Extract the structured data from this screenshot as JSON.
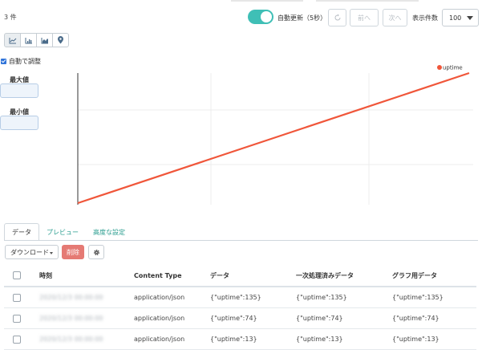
{
  "count_label": "3 件",
  "toolbar": {
    "auto_refresh_label": "自動更新（5秒）",
    "prev_label": "前へ",
    "next_label": "次へ",
    "per_page_label": "表示件数",
    "per_page_value": "100"
  },
  "chart_types": [
    "line-chart-icon",
    "bar-chart-icon",
    "area-chart-icon",
    "map-pin-icon"
  ],
  "autoscale_label": "自動で調整",
  "max_label": "最大値",
  "min_label": "最小値",
  "chart_data": {
    "type": "line",
    "series": [
      {
        "name": "uptime",
        "color": "#f0563a",
        "x": [
          0,
          1,
          2
        ],
        "values": [
          13,
          74,
          135
        ]
      }
    ],
    "legend": "top-right",
    "grid": true
  },
  "tabs": [
    "データ",
    "プレビュー",
    "高度な設定"
  ],
  "actions": {
    "download_label": "ダウンロード",
    "delete_label": "削除"
  },
  "table": {
    "headers": [
      "時刻",
      "Content Type",
      "データ",
      "一次処理済みデータ",
      "グラフ用データ"
    ],
    "rows": [
      {
        "time": "2020/12/3 00:00:00",
        "ctype": "application/json",
        "data": "{\"uptime\":135}",
        "processed": "{\"uptime\":135}",
        "graph": "{\"uptime\":135}"
      },
      {
        "time": "2020/12/3 00:00:00",
        "ctype": "application/json",
        "data": "{\"uptime\":74}",
        "processed": "{\"uptime\":74}",
        "graph": "{\"uptime\":74}"
      },
      {
        "time": "2020/12/3 00:00:00",
        "ctype": "application/json",
        "data": "{\"uptime\":13}",
        "processed": "{\"uptime\":13}",
        "graph": "{\"uptime\":13}"
      }
    ]
  },
  "colors": {
    "accent": "#3fbfb6",
    "danger": "#e57a74",
    "series": "#f0563a",
    "checkbox": "#2f73d9"
  }
}
